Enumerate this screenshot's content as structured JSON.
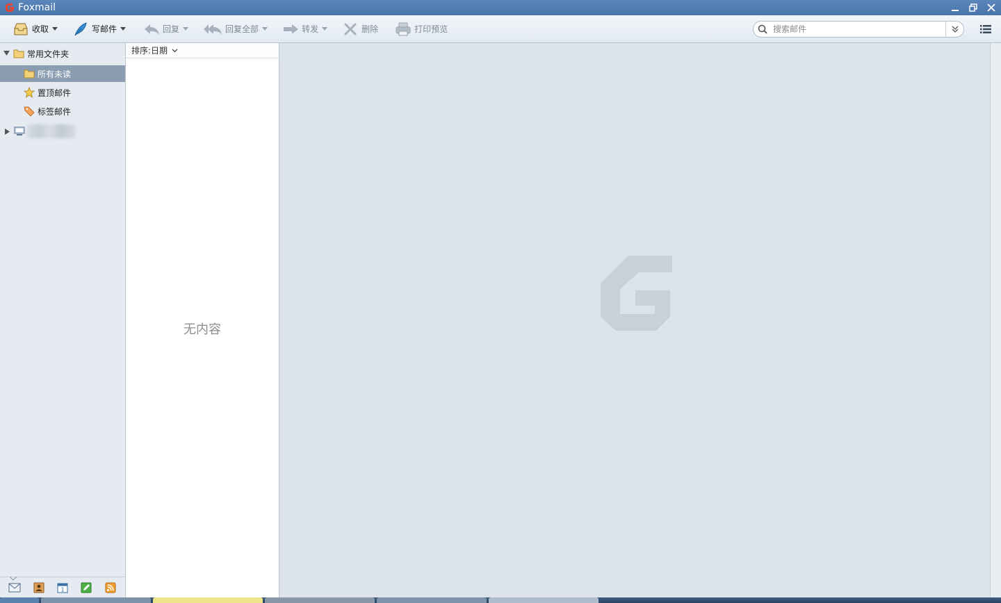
{
  "window": {
    "title": "Foxmail"
  },
  "toolbar": {
    "receive": "收取",
    "compose": "写邮件",
    "reply": "回复",
    "reply_all": "回复全部",
    "forward": "转发",
    "delete": "删除",
    "print_preview": "打印预览"
  },
  "search": {
    "placeholder": "搜索邮件",
    "value": ""
  },
  "sidebar": {
    "common_folders": "常用文件夹",
    "items": [
      {
        "label": "所有未读",
        "icon": "folder-icon",
        "selected": true
      },
      {
        "label": "置顶邮件",
        "icon": "star-icon",
        "selected": false
      },
      {
        "label": "标签邮件",
        "icon": "tag-icon",
        "selected": false
      }
    ],
    "bottom_icons": [
      "mail-icon",
      "contacts-icon",
      "calendar-icon",
      "notes-icon",
      "rss-icon"
    ]
  },
  "mail_list": {
    "sort_label": "排序:日期",
    "empty_text": "无内容"
  },
  "colors": {
    "titlebar": "#4a75ab",
    "selected_row": "#8b9db0",
    "preview_bg": "#dce3eb",
    "accent_red": "#d43a2a"
  }
}
